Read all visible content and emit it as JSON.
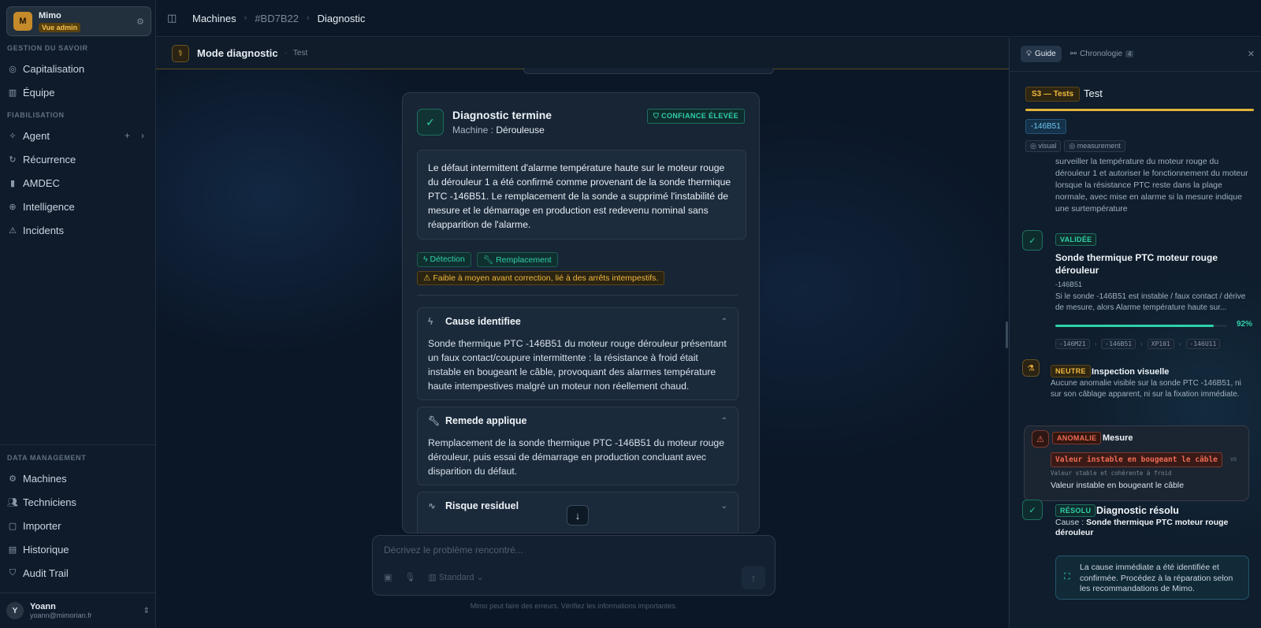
{
  "workspace": {
    "avatar": "M",
    "name": "Mimo",
    "badge": "Vue admin"
  },
  "sidebar": {
    "section_knowledge": "GESTION DU SAVOIR",
    "section_reliability": "FIABILISATION",
    "section_data": "DATA MANAGEMENT",
    "items": [
      {
        "label": "Capitalisation",
        "icon": "capitalisation-icon"
      },
      {
        "label": "Équipe",
        "icon": "book-icon"
      },
      {
        "label": "Agent",
        "icon": "sparkle-icon"
      },
      {
        "label": "Récurrence",
        "icon": "recurrence-icon"
      },
      {
        "label": "AMDEC",
        "icon": "chart-icon"
      },
      {
        "label": "Intelligence",
        "icon": "globe-icon"
      },
      {
        "label": "Incidents",
        "icon": "warning-icon"
      },
      {
        "label": "Machines",
        "icon": "gear-icon"
      },
      {
        "label": "Techniciens",
        "icon": "users-icon"
      },
      {
        "label": "Importer",
        "icon": "file-icon"
      },
      {
        "label": "Historique",
        "icon": "history-icon"
      },
      {
        "label": "Audit Trail",
        "icon": "shield-icon"
      }
    ]
  },
  "user": {
    "avatar": "Y",
    "name": "Yoann",
    "email": "yoann@mimorian.fr"
  },
  "breadcrumb": [
    "Machines",
    "#BD7B22",
    "Diagnostic"
  ],
  "mode": {
    "title": "Mode diagnostic",
    "subtitle": "Test"
  },
  "card": {
    "title": "Diagnostic termine",
    "machine_label": "Machine :",
    "machine_value": "Dérouleuse",
    "confidence": "CONFIANCE ÉLEVÉE",
    "summary": "Le défaut intermittent d'alarme température haute sur le moteur rouge du dérouleur 1 a été confirmé comme provenant de la sonde thermique PTC -146B51. Le remplacement de la sonde a supprimé l'instabilité de mesure et le démarrage en production est redevenu nominal sans réapparition de l'alarme.",
    "chip_detection": "Détection",
    "chip_replacement": "Remplacement",
    "warning": "Faible à moyen avant correction, lié à des arrêts intempestifs.",
    "cause_title": "Cause identifiee",
    "cause_body": "Sonde thermique PTC -146B51 du moteur rouge dérouleur présentant un faux contact/coupure intermittente : la résistance à froid était instable en bougeant le câble, provoquant des alarmes température haute intempestives malgré un moteur non réellement chaud.",
    "remedy_title": "Remede applique",
    "remedy_body": "Remplacement de la sonde thermique PTC -146B51 du moteur rouge dérouleur, puis essai de démarrage en production concluant avec disparition du défaut.",
    "risk_title": "Risque residuel"
  },
  "composer": {
    "placeholder": "Décrivez le problème rencontré...",
    "mode": "Standard",
    "disclaimer": "Mimo peut faire des erreurs. Vérifiez les informations importantes."
  },
  "panel": {
    "tab_guide": "Guide",
    "tab_timeline": "Chronologie",
    "tab_timeline_count": "4",
    "step_badge": "S3 — Tests",
    "step_title": "Test",
    "tag": "-146B51",
    "chip_visual": "visual",
    "chip_measurement": "measurement",
    "intro_text": "surveiller la température du moteur rouge du dérouleur 1 et autoriser le fonctionnement du moteur lorsque la résistance PTC reste dans la plage normale, avec mise en alarme si la mesure indique une surtempérature",
    "validated_badge": "VALIDÉE",
    "validated_title": "Sonde thermique PTC moteur rouge dérouleur",
    "validated_ref": "-146B51",
    "validated_text": "Si le sonde -146B51 est instable / faux contact / dérive de mesure, alors Alarme température haute sur...",
    "validated_confidence": 0.92,
    "validated_confidence_label": "92%",
    "pipeline": [
      "-146M21",
      "-146B51",
      "XP101",
      "-146U11"
    ],
    "neutral_badge": "NEUTRE",
    "neutral_title": "Inspection visuelle",
    "neutral_text": "Aucune anomalie visible sur la sonde PTC -146B51, ni sur son câblage apparent, ni sur la fixation immédiate.",
    "anomaly_badge": "ANOMALIE",
    "anomaly_title": "Mesure",
    "anomaly_value": "Valeur instable en bougeant le câble",
    "anomaly_vs": "vs",
    "anomaly_expected": "Valeur stable et cohérente à froid",
    "anomaly_observed": "Valeur instable en bougeant le câble",
    "resolved_badge": "RÉSOLU",
    "resolved_title": "Diagnostic résolu",
    "resolved_cause_label": "Cause :",
    "resolved_cause_value": "Sonde thermique PTC moteur rouge dérouleur",
    "resolved_note": "La cause immédiate a été identifiée et confirmée. Procédez à la réparation selon les recommandations de Mimo."
  },
  "colors": {
    "accent_teal": "#2fd1a8",
    "accent_amber": "#f0b93f",
    "accent_red": "#ee6b55",
    "background": "#0a1626"
  }
}
